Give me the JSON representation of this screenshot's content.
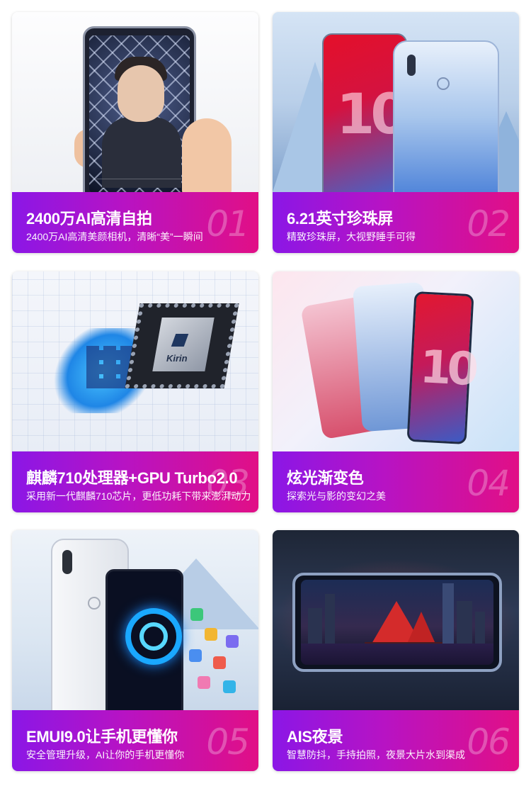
{
  "cards": [
    {
      "title": "2400万AI高清自拍",
      "subtitle": "2400万AI高清美颜相机，清晰“美”一瞬间",
      "number": "01"
    },
    {
      "title": "6.21英寸珍珠屏",
      "subtitle": "精致珍珠屏，大视野睡手可得",
      "number": "02"
    },
    {
      "title": "麒麟710处理器+GPU Turbo2.0",
      "subtitle": "采用新一代麒麟710芯片，更低功耗下带来澎湃动力",
      "number": "03"
    },
    {
      "title": "炫光渐变色",
      "subtitle": "探索光与影的变幻之美",
      "number": "04"
    },
    {
      "title": "EMUI9.0让手机更懂你",
      "subtitle": "安全管理升级，AI让你的手机更懂你",
      "number": "05"
    },
    {
      "title": "AIS夜景",
      "subtitle": "智慧防抖，手持拍照，夜景大片水到渠成",
      "number": "06"
    }
  ],
  "images": {
    "chip_label": "Kirin",
    "phone_badge": "10"
  },
  "colors": {
    "caption_gradient_start": "#8b17e6",
    "caption_gradient_end": "#e10f86"
  }
}
